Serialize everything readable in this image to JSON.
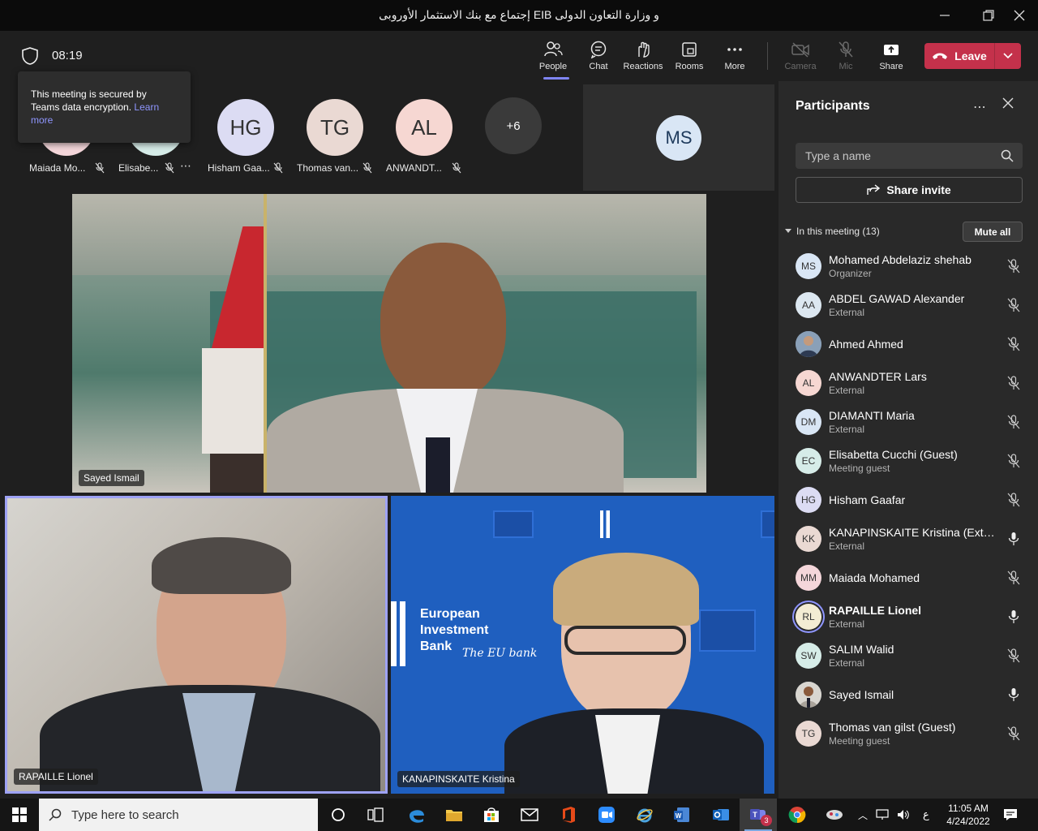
{
  "window": {
    "title": "إجتماع مع بنك الاستثمار الأوروبى EIB و وزارة التعاون الدولى"
  },
  "toolbar": {
    "timer": "08:19",
    "people": "People",
    "chat": "Chat",
    "reactions": "Reactions",
    "rooms": "Rooms",
    "more": "More",
    "camera": "Camera",
    "mic": "Mic",
    "share": "Share",
    "leave": "Leave"
  },
  "tooltip": {
    "text": "This meeting is secured by Teams data encryption.",
    "link": "Learn more"
  },
  "gallery": {
    "items": [
      {
        "initials": "",
        "name": "Maiada Mo...",
        "color": "#f4d6da"
      },
      {
        "initials": "",
        "name": "Elisabe...",
        "color": "#d6ece8"
      },
      {
        "initials": "HG",
        "name": "Hisham Gaa...",
        "color": "#dcdcf3"
      },
      {
        "initials": "TG",
        "name": "Thomas van...",
        "color": "#ead9d3"
      },
      {
        "initials": "AL",
        "name": "ANWANDT...",
        "color": "#f6d7d2"
      }
    ],
    "overflow": "+6",
    "pinned_initials": "MS"
  },
  "videos": {
    "main_label": "Sayed Ismail",
    "bottom_left_label": "RAPAILLE Lionel",
    "bottom_right_label": "KANAPINSKAITE Kristina",
    "eib_text_1": "European",
    "eib_text_2": "Investment",
    "eib_text_3": "Bank",
    "eib_script": "The EU bank"
  },
  "panel": {
    "title": "Participants",
    "search_placeholder": "Type a name",
    "share_invite": "Share invite",
    "section": "In this meeting (13)",
    "mute_all": "Mute all",
    "participants": [
      {
        "initials": "MS",
        "name": "Mohamed Abdelaziz shehab",
        "role": "Organizer",
        "color": "#d9e6f5",
        "muted": true
      },
      {
        "initials": "AA",
        "name": "ABDEL GAWAD Alexander",
        "role": "External",
        "color": "#dce7f0",
        "muted": true
      },
      {
        "initials": "",
        "name": "Ahmed Ahmed",
        "role": "",
        "color": "#7a8ca3",
        "muted": true,
        "photo": true
      },
      {
        "initials": "AL",
        "name": "ANWANDTER Lars",
        "role": "External",
        "color": "#f6d7d2",
        "muted": true
      },
      {
        "initials": "DM",
        "name": "DIAMANTI Maria",
        "role": "External",
        "color": "#d9e6f5",
        "muted": true
      },
      {
        "initials": "EC",
        "name": "Elisabetta Cucchi (Guest)",
        "role": "Meeting guest",
        "color": "#d6ece8",
        "muted": true
      },
      {
        "initials": "HG",
        "name": "Hisham Gaafar",
        "role": "",
        "color": "#dcdcf3",
        "muted": true
      },
      {
        "initials": "KK",
        "name": "KANAPINSKAITE Kristina (Extern...",
        "role": "External",
        "color": "#ead9d3",
        "muted": false
      },
      {
        "initials": "MM",
        "name": "Maiada Mohamed",
        "role": "",
        "color": "#f4d6da",
        "muted": true
      },
      {
        "initials": "RL",
        "name": "RAPAILLE Lionel",
        "role": "External",
        "color": "#f3ecd3",
        "muted": false,
        "speaking": true
      },
      {
        "initials": "SW",
        "name": "SALIM Walid",
        "role": "External",
        "color": "#d6ece8",
        "muted": true
      },
      {
        "initials": "",
        "name": "Sayed Ismail",
        "role": "",
        "color": "#7a6a5e",
        "muted": false,
        "photo": true
      },
      {
        "initials": "TG",
        "name": "Thomas van gilst (Guest)",
        "role": "Meeting guest",
        "color": "#ead9d3",
        "muted": true
      }
    ]
  },
  "taskbar": {
    "search_placeholder": "Type here to search",
    "time": "11:05 AM",
    "date": "4/24/2022",
    "lang": "ع",
    "teams_badge": "3"
  }
}
